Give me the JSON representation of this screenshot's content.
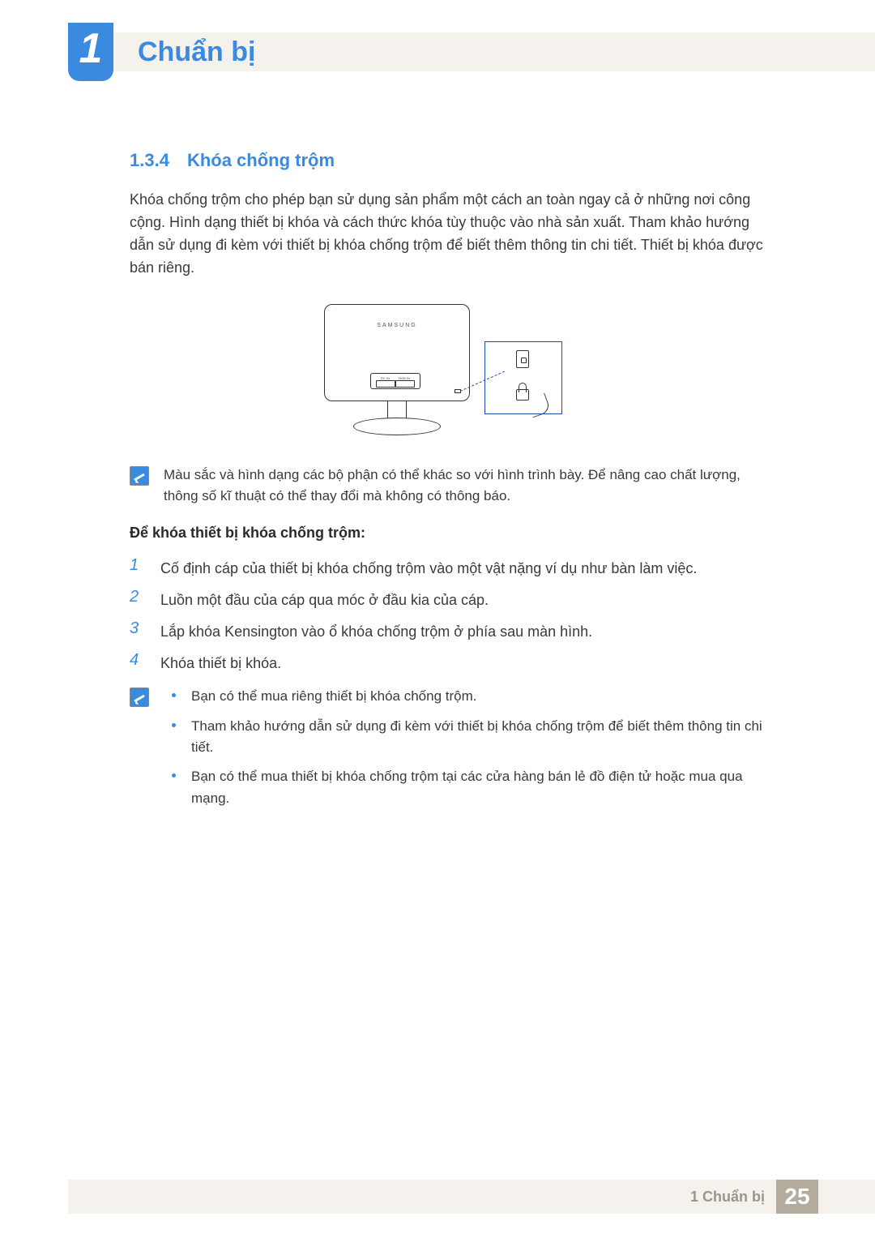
{
  "header": {
    "chapter_number": "1",
    "chapter_title": "Chuẩn bị"
  },
  "section": {
    "number": "1.3.4",
    "title": "Khóa chống trộm",
    "intro": "Khóa chống trộm cho phép bạn sử dụng sản phẩm một cách an toàn ngay cả ở những nơi công cộng. Hình dạng thiết bị khóa và cách thức khóa tùy thuộc vào nhà sản xuất. Tham khảo hướng dẫn sử dụng đi kèm với thiết bị khóa chống trộm để biết thêm thông tin chi tiết. Thiết bị khóa được bán riêng."
  },
  "illustration": {
    "brand_text": "SAMSUNG",
    "port_left": "DC IN",
    "port_right": "RGB IN"
  },
  "note_color": "Màu sắc và hình dạng các bộ phận có thể khác so với hình trình bày. Để nâng cao chất lượng, thông số kĩ thuật có thể thay đổi mà không có thông báo.",
  "subheading": "Để khóa thiết bị khóa chống trộm:",
  "steps": [
    {
      "n": "1",
      "t": "Cố định cáp của thiết bị khóa chống trộm vào một vật nặng ví dụ như bàn làm việc."
    },
    {
      "n": "2",
      "t": "Luồn một đầu của cáp qua móc ở đầu kia của cáp."
    },
    {
      "n": "3",
      "t": "Lắp khóa Kensington vào ổ khóa chống trộm ở phía sau màn hình."
    },
    {
      "n": "4",
      "t": "Khóa thiết bị khóa."
    }
  ],
  "note_bullets": [
    "Bạn có thể mua riêng thiết bị khóa chống trộm.",
    "Tham khảo hướng dẫn sử dụng đi kèm với thiết bị khóa chống trộm để biết thêm thông tin chi tiết.",
    "Bạn có thể mua thiết bị khóa chống trộm tại các cửa hàng bán lẻ đồ điện tử hoặc mua qua mạng."
  ],
  "footer": {
    "chapter_label": "1 Chuẩn bị",
    "page_number": "25"
  }
}
